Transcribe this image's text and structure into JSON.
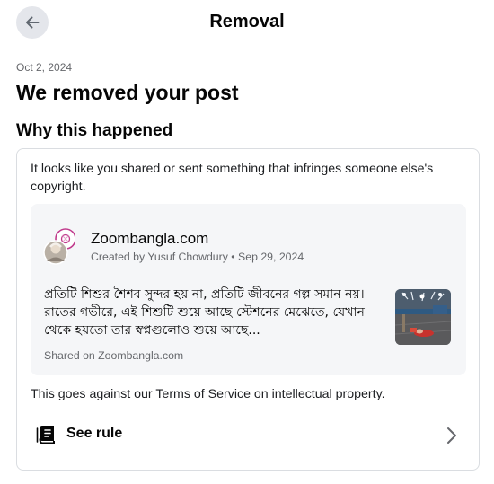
{
  "header": {
    "title": "Removal",
    "back_icon": "arrow-left-icon"
  },
  "notice": {
    "date": "Oct 2, 2024",
    "title": "We removed your post",
    "section_title": "Why this happened"
  },
  "card": {
    "intro": "It looks like you shared or sent something that infringes someone else's copyright.",
    "post": {
      "page_name": "Zoombangla.com",
      "created": "Created by Yusuf Chowdury • Sep 29, 2024",
      "text": "প্রতিটি শিশুর শৈশব সুন্দর হয় না, প্রতিটি জীবনের গল্প সমান নয়। রাতের গভীরে, এই শিশুটি শুয়ে আছে স্টেশনের মেঝেতে, যেখান থেকে হয়তো তার স্বপ্নগুলোও শুয়ে আছে...",
      "shared": "Shared on Zoombangla.com"
    },
    "terms": "This goes against our Terms of Service on intellectual property.",
    "see_rule_label": "See rule",
    "rule_icon": "book-icon",
    "chevron_icon": "chevron-right-icon"
  },
  "colors": {
    "text_primary": "#050505",
    "text_secondary": "#65676b",
    "border": "#dadde1",
    "post_background": "#f5f6f8",
    "button_background": "#e4e6eb"
  }
}
